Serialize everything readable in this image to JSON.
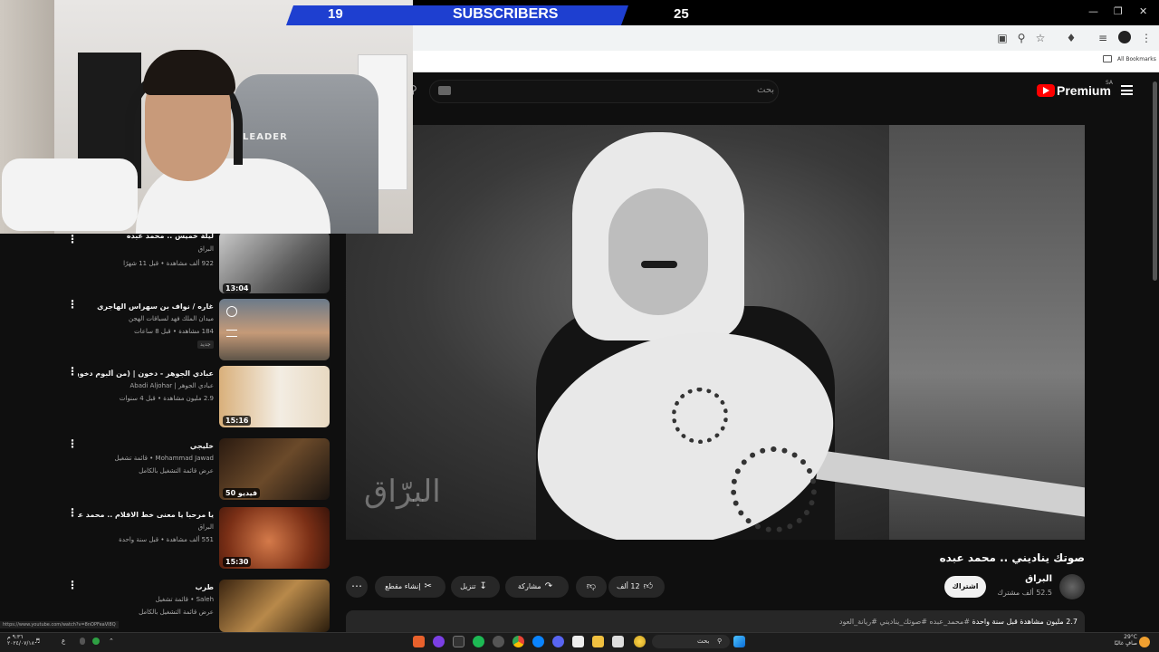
{
  "stream_overlay": {
    "subscribers_label": "SUBSCRIBERS",
    "left_count": "19",
    "right_count": "25",
    "bar_color": "#1e3fd0"
  },
  "webcam": {
    "chair_text": "LEADER"
  },
  "browser": {
    "bookmarks_label": "All Bookmarks",
    "icons": [
      "cast-icon",
      "zoom-icon",
      "star-icon",
      "extensions-icon",
      "playlist-icon",
      "profile-icon",
      "more-icon"
    ]
  },
  "youtube": {
    "search_placeholder": "بحث",
    "logo_text": "Premium",
    "region": "SA",
    "accent": "#ff0000",
    "video": {
      "title": "صوتك يناديني .. محمد عبده",
      "watermark": "البرّاق",
      "channel": "البراق",
      "subscribers": "52.5 ألف مشترك",
      "subscribe_label": "اشتراك",
      "likes": "12 ألف",
      "share_label": "مشاركة",
      "download_label": "تنزيل",
      "clip_label": "إنشاء مقطع",
      "views_line": "2.7 مليون مشاهدة  قبل سنة واحدة",
      "hashtags": "#محمد_عبده #صوتك_يناديني #ريانة_العود"
    },
    "sidebar": [
      {
        "title": "ليلة خميس .. محمد عبده",
        "channel": "البراق",
        "meta": "922 ألف مشاهدة • قبل 11 شهرًا",
        "duration": "13:04"
      },
      {
        "title": "غاره / نواف بن سهراس الهاجري",
        "channel": "ميدان الملك فهد لسباقات الهجن",
        "meta": "184 مشاهدة • قبل 8 ساعات",
        "duration": "",
        "badge": "جديد"
      },
      {
        "title": "عبادي الجوهر - دخون | (من ألبوم دخون)",
        "channel": "عبادي الجوهر | Abadi Aljohar",
        "meta": "2.9 مليون مشاهدة • قبل 4 سنوات",
        "duration": "15:16"
      },
      {
        "title": "خليجي",
        "channel": "Mohammad Jawad • قائمة تشغيل",
        "meta": "عرض قائمة التشغيل بالكامل",
        "duration": "50 فيديو"
      },
      {
        "title": "يا مرحبا يا معنى خط الاقلام .. محمد عبده",
        "channel": "البراق",
        "meta": "551 ألف مشاهدة • قبل سنة واحدة",
        "duration": "15:30"
      },
      {
        "title": "طرب",
        "channel": "Saleh • قائمة تشغيل",
        "meta": "عرض قائمة التشغيل بالكامل",
        "duration": ""
      }
    ],
    "status_url": "https://www.youtube.com/watch?v=8nOPFeaVl8Q"
  },
  "taskbar": {
    "search_placeholder": "بحث",
    "time": "٩:٣٦ م",
    "date": "٢٠٢٤/٠٧/١٨",
    "weather": "29°C",
    "weather_text": "صافٍ غالبًا",
    "lang": "ع"
  }
}
